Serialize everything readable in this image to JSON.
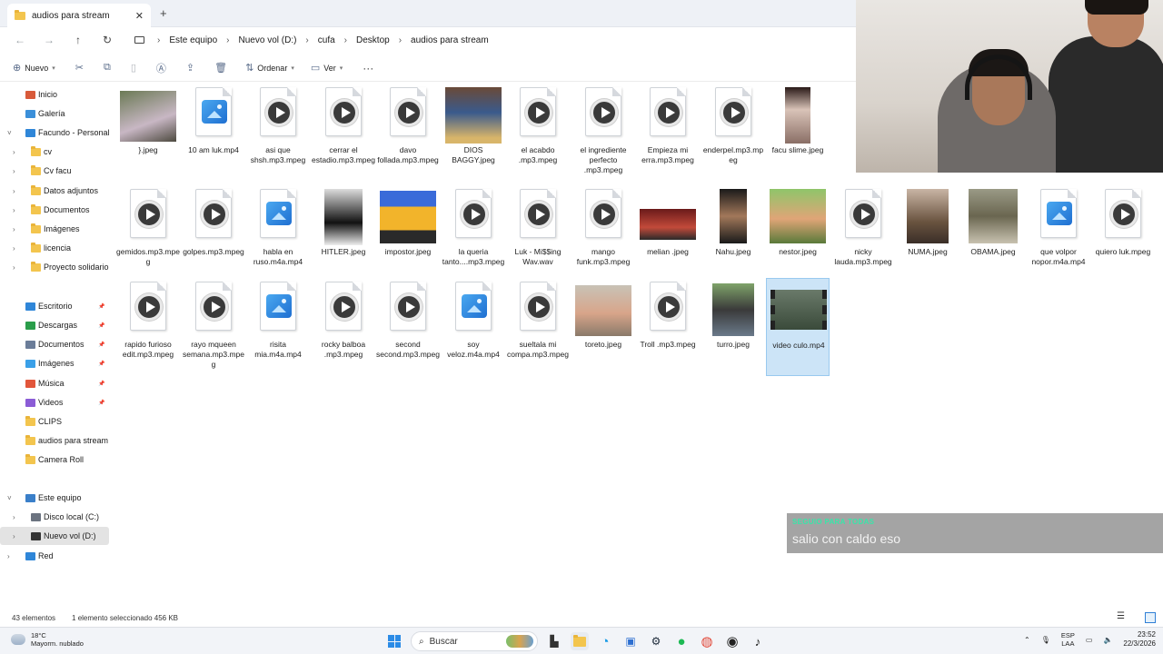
{
  "window": {
    "tab_title": "audios para stream",
    "close_glyph": "✕",
    "newtab_glyph": "+"
  },
  "address": {
    "back": "←",
    "forward": "→",
    "up": "↑",
    "refresh": "↻",
    "crumbs": [
      "Este equipo",
      "Nuevo vol (D:)",
      "cufa",
      "Desktop",
      "audios para stream"
    ],
    "sep": "›"
  },
  "toolbar": {
    "new_label": "Nuevo",
    "sort_label": "Ordenar",
    "view_label": "Ver",
    "more": "···"
  },
  "nav": {
    "items": [
      {
        "label": "Inicio",
        "icon": "home-icon"
      },
      {
        "label": "Galería",
        "icon": "gallery-icon"
      },
      {
        "label": "Facundo - Personal",
        "icon": "cloud-icon"
      },
      {
        "label": "cv"
      },
      {
        "label": "Cv facu"
      },
      {
        "label": "Datos adjuntos"
      },
      {
        "label": "Documentos"
      },
      {
        "label": "Imágenes"
      },
      {
        "label": "licencia"
      },
      {
        "label": "Proyecto solidario"
      },
      {
        "label": "Escritorio",
        "icon": "desktop-icon"
      },
      {
        "label": "Descargas",
        "icon": "download-icon"
      },
      {
        "label": "Documentos",
        "icon": "documents-icon"
      },
      {
        "label": "Imágenes",
        "icon": "pictures-icon"
      },
      {
        "label": "Música",
        "icon": "music-icon"
      },
      {
        "label": "Videos",
        "icon": "videos-icon"
      },
      {
        "label": "CLIPS"
      },
      {
        "label": "audios para stream"
      },
      {
        "label": "Camera Roll"
      },
      {
        "label": "Este equipo",
        "icon": "pc-icon"
      },
      {
        "label": "Disco local (C:)",
        "icon": "drive-icon"
      },
      {
        "label": "Nuevo vol (D:)",
        "icon": "drive-icon"
      },
      {
        "label": "Red",
        "icon": "network-icon"
      }
    ]
  },
  "files": [
    {
      "name": "}.jpeg",
      "kind": "image"
    },
    {
      "name": "10 am luk.mp4",
      "kind": "media"
    },
    {
      "name": "asi que shsh.mp3.mpeg",
      "kind": "audio"
    },
    {
      "name": "cerrar el estadio.mp3.mpeg",
      "kind": "audio"
    },
    {
      "name": "davo follada.mp3.mpeg",
      "kind": "audio"
    },
    {
      "name": "DIOS BAGGY.jpeg",
      "kind": "image"
    },
    {
      "name": "el acabdo .mp3.mpeg",
      "kind": "audio"
    },
    {
      "name": "el ingrediente perfecto .mp3.mpeg",
      "kind": "audio"
    },
    {
      "name": "Empieza mi erra.mp3.mpeg",
      "kind": "audio"
    },
    {
      "name": "enderpel.mp3.mpeg",
      "kind": "audio"
    },
    {
      "name": "facu slime.jpeg",
      "kind": "image"
    },
    {
      "name": "facu",
      "kind": "image"
    },
    {
      "name": "gemidos.mp3.mpeg",
      "kind": "audio"
    },
    {
      "name": "golpes.mp3.mpeg",
      "kind": "audio"
    },
    {
      "name": "habla en ruso.m4a.mp4",
      "kind": "media"
    },
    {
      "name": "HITLER.jpeg",
      "kind": "image"
    },
    {
      "name": "impostor.jpeg",
      "kind": "image"
    },
    {
      "name": "la queria tanto....mp3.mpeg",
      "kind": "audio"
    },
    {
      "name": "Luk - Mi$$ing Wav.wav",
      "kind": "audio"
    },
    {
      "name": "mango funk.mp3.mpeg",
      "kind": "audio"
    },
    {
      "name": "melian .jpeg",
      "kind": "image"
    },
    {
      "name": "Nahu.jpeg",
      "kind": "image"
    },
    {
      "name": "nestor.jpeg",
      "kind": "image"
    },
    {
      "name": "nicky lauda.mp3.mpeg",
      "kind": "audio"
    },
    {
      "name": "NUMA.jpeg",
      "kind": "image"
    },
    {
      "name": "OBAMA.jpeg",
      "kind": "image"
    },
    {
      "name": "que volpor nopor.m4a.mp4",
      "kind": "media"
    },
    {
      "name": "quiero luk.mpeg",
      "kind": "audio"
    },
    {
      "name": "rapido furioso edit.mp3.mpeg",
      "kind": "audio"
    },
    {
      "name": "rayo mqueen semana.mp3.mpeg",
      "kind": "audio"
    },
    {
      "name": "risita mia.m4a.mp4",
      "kind": "media"
    },
    {
      "name": "rocky balboa .mp3.mpeg",
      "kind": "audio"
    },
    {
      "name": "second second.mp3.mpeg",
      "kind": "audio"
    },
    {
      "name": "soy veloz.m4a.mp4",
      "kind": "media"
    },
    {
      "name": "sueltala mi compa.mp3.mpeg",
      "kind": "audio"
    },
    {
      "name": "toreto.jpeg",
      "kind": "image"
    },
    {
      "name": "Troll .mp3.mpeg",
      "kind": "audio"
    },
    {
      "name": "turro.jpeg",
      "kind": "image"
    },
    {
      "name": "video culo.mp4",
      "kind": "video",
      "selected": true
    }
  ],
  "status": {
    "count": "43 elementos",
    "selection": "1 elemento seleccionado  456 KB"
  },
  "chat": {
    "user": "SEGUIO PARA TODAS",
    "message": "salio con caldo eso"
  },
  "taskbar": {
    "temp": "18°C",
    "weather": "Mayorm. nublado",
    "search_placeholder": "Buscar",
    "lang_top": "ESP",
    "lang_bottom": "LAA",
    "time": "23:52",
    "date": "22/3/2026"
  }
}
